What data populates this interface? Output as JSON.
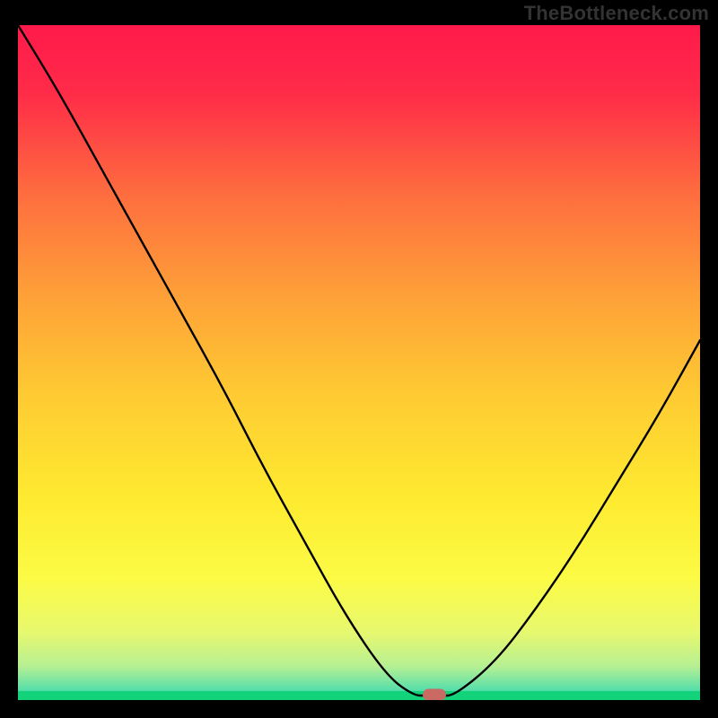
{
  "attribution": "TheBottleneck.com",
  "chart_data": {
    "type": "line",
    "title": "",
    "xlabel": "",
    "ylabel": "",
    "x": [
      0.0,
      0.06,
      0.12,
      0.18,
      0.24,
      0.3,
      0.36,
      0.42,
      0.48,
      0.54,
      0.58,
      0.6,
      0.62,
      0.64,
      0.7,
      0.76,
      0.82,
      0.88,
      0.94,
      1.0
    ],
    "values": [
      1.0,
      0.9,
      0.79,
      0.68,
      0.57,
      0.46,
      0.34,
      0.23,
      0.12,
      0.03,
      0.0,
      0.0,
      0.0,
      0.0,
      0.05,
      0.13,
      0.22,
      0.32,
      0.42,
      0.53
    ],
    "xlim": [
      0,
      1
    ],
    "ylim": [
      0,
      1
    ],
    "min_marker_x": 0.61,
    "gradient_stops": [
      {
        "pos": 0.0,
        "color": "#ff1a4b"
      },
      {
        "pos": 0.1,
        "color": "#ff2b48"
      },
      {
        "pos": 0.25,
        "color": "#fe6d3f"
      },
      {
        "pos": 0.4,
        "color": "#fea038"
      },
      {
        "pos": 0.55,
        "color": "#fecb32"
      },
      {
        "pos": 0.7,
        "color": "#feea30"
      },
      {
        "pos": 0.82,
        "color": "#fcfb45"
      },
      {
        "pos": 0.9,
        "color": "#e7f86f"
      },
      {
        "pos": 0.95,
        "color": "#b6f093"
      },
      {
        "pos": 0.985,
        "color": "#57deaa"
      },
      {
        "pos": 1.0,
        "color": "#12d37a"
      }
    ]
  }
}
